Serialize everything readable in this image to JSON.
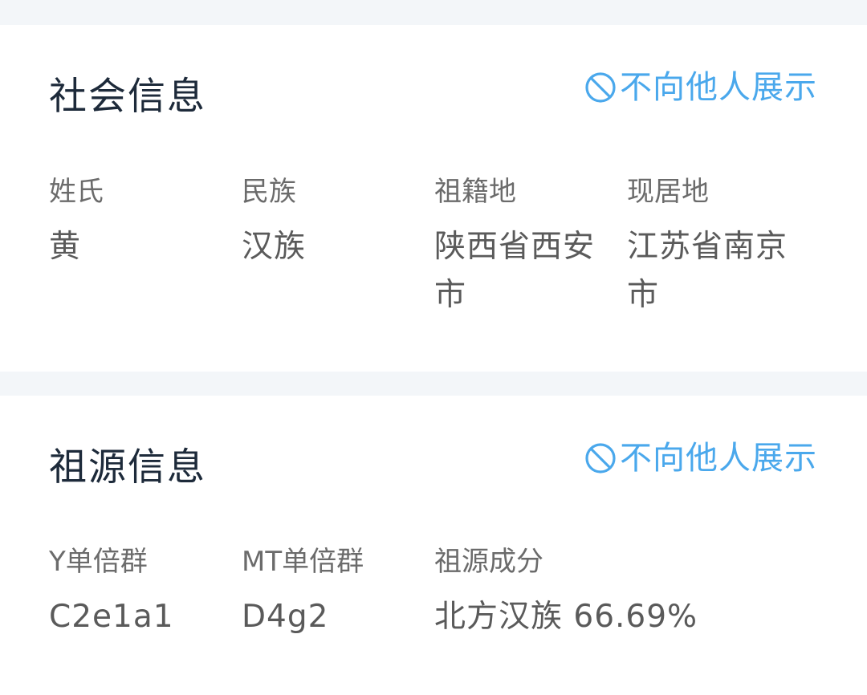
{
  "social_info": {
    "title": "社会信息",
    "privacy_label": "不向他人展示",
    "fields": [
      {
        "label": "姓氏",
        "value": "黄"
      },
      {
        "label": "民族",
        "value": "汉族"
      },
      {
        "label": "祖籍地",
        "value": "陕西省西安市"
      },
      {
        "label": "现居地",
        "value": "江苏省南京市"
      }
    ]
  },
  "ancestry_info": {
    "title": "祖源信息",
    "privacy_label": "不向他人展示",
    "fields": [
      {
        "label": "Y单倍群",
        "value": "C2e1a1"
      },
      {
        "label": "MT单倍群",
        "value": "D4g2"
      },
      {
        "label": "祖源成分",
        "value": "北方汉族 66.69%"
      }
    ]
  },
  "colors": {
    "accent": "#4aa8ec",
    "title": "#1d2a3a",
    "label": "#6b6b6b",
    "value": "#5a5a5a",
    "background": "#f3f6f9",
    "card": "#ffffff"
  },
  "icons": {
    "privacy": "no-entry-icon"
  }
}
